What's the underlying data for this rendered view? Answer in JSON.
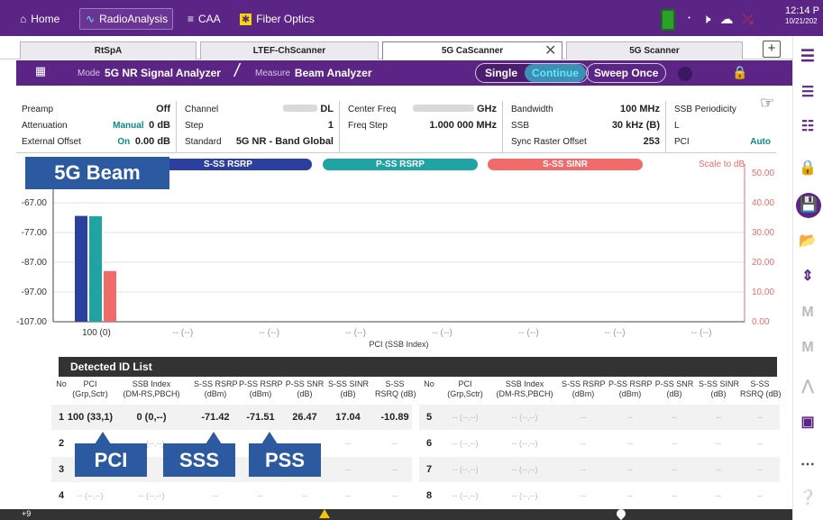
{
  "topbar": {
    "home": "Home",
    "radio_analysis": "RadioAnalysis",
    "caa": "CAA",
    "fiber_optics": "Fiber Optics",
    "time": "12:14 P",
    "date": "10/21/202"
  },
  "tabs": [
    {
      "label": "RtSpA"
    },
    {
      "label": "LTEF-ChScanner"
    },
    {
      "label": "5G CaScanner"
    },
    {
      "label": "5G Scanner"
    }
  ],
  "modebar": {
    "mode_label": "Mode",
    "mode_value": "5G NR Signal Analyzer",
    "measure_label": "Measure",
    "measure_value": "Beam Analyzer",
    "single": "Single",
    "continue": "Continue",
    "sweep_once": "Sweep Once"
  },
  "params": {
    "preamp_label": "Preamp",
    "preamp_value": "Off",
    "attenuation_label": "Attenuation",
    "attenuation_mode": "Manual",
    "attenuation_value": "0 dB",
    "ext_offset_label": "External Offset",
    "ext_offset_state": "On",
    "ext_offset_value": "0.00 dB",
    "channel_label": "Channel",
    "channel_suffix": "DL",
    "step_label": "Step",
    "step_value": "1",
    "standard_label": "Standard",
    "standard_value": "5G NR - Band Global",
    "center_freq_label": "Center Freq",
    "center_freq_unit": "GHz",
    "freq_step_label": "Freq Step",
    "freq_step_value": "1.000 000 MHz",
    "bandwidth_label": "Bandwidth",
    "bandwidth_value": "100 MHz",
    "ssb_label": "SSB",
    "ssb_value": "30 kHz (B)",
    "sync_raster_label": "Sync Raster Offset",
    "sync_raster_value": "253",
    "ssb_periodicity_label": "SSB Periodicity",
    "ssb_periodicity_value": "L",
    "pci_label": "PCI",
    "pci_value": "Auto"
  },
  "chart_legend": {
    "sss_rsrp": "S-SS RSRP",
    "pss_rsrp": "P-SS RSRP",
    "sss_sinr": "S-SS SINR",
    "scale": "Scale to dB"
  },
  "chart_data": {
    "type": "bar",
    "xlabel": "PCI (SSB Index)",
    "categories": [
      "100 (0)",
      "-- (--)",
      "-- (--)",
      "-- (--)",
      "-- (--)",
      "-- (--)",
      "-- (--)",
      "-- (--)"
    ],
    "y_left_ticks": [
      "-67.00",
      "-77.00",
      "-87.00",
      "-97.00",
      "-107.00"
    ],
    "y_right_ticks": [
      "50.00",
      "40.00",
      "30.00",
      "20.00",
      "10.00",
      "0.00"
    ],
    "ylim_left": [
      -107,
      -57
    ],
    "ylim_right": [
      0,
      50
    ],
    "series": [
      {
        "name": "S-SS RSRP",
        "color": "#2b3f9e",
        "axis": "left",
        "values": [
          -71.42
        ]
      },
      {
        "name": "P-SS RSRP",
        "color": "#1fa3a3",
        "axis": "left",
        "values": [
          -71.51
        ]
      },
      {
        "name": "S-SS SINR",
        "color": "#f26b6b",
        "axis": "right",
        "values": [
          17.04
        ]
      }
    ]
  },
  "callouts": {
    "beam": "5G Beam",
    "pci": "PCI",
    "sss": "SSS",
    "pss": "PSS"
  },
  "table": {
    "title": "Detected ID List",
    "headers": [
      "No",
      "PCI\n(Grp,Sctr)",
      "SSB Index\n(DM-RS,PBCH)",
      "S-SS RSRP\n(dBm)",
      "P-SS RSRP\n(dBm)",
      "P-SS SNR\n(dB)",
      "S-SS SINR\n(dB)",
      "S-SS\nRSRQ (dB)"
    ],
    "rows_left": [
      {
        "no": "1",
        "pci": "100 (33,1)",
        "ssb": "0 (0,--)",
        "sss_rsrp": "-71.42",
        "pss_rsrp": "-71.51",
        "pss_snr": "26.47",
        "sss_sinr": "17.04",
        "sss_rsrq": "-10.89"
      },
      {
        "no": "2",
        "pci": "",
        "ssb": "-- (--,--)",
        "sss_rsrp": "",
        "pss_rsrp": "--",
        "pss_snr": "--",
        "sss_sinr": "--",
        "sss_rsrq": "--"
      },
      {
        "no": "3",
        "pci": "",
        "ssb": "",
        "sss_rsrp": "",
        "pss_rsrp": "",
        "pss_snr": "--",
        "sss_sinr": "--",
        "sss_rsrq": "--"
      },
      {
        "no": "4",
        "pci": "-- (--,--)",
        "ssb": "-- (--,--)",
        "sss_rsrp": "--",
        "pss_rsrp": "--",
        "pss_snr": "--",
        "sss_sinr": "--",
        "sss_rsrq": "--"
      }
    ],
    "rows_right": [
      {
        "no": "5",
        "pci": "-- (--,--)",
        "ssb": "-- (--,--)",
        "sss_rsrp": "--",
        "pss_rsrp": "--",
        "pss_snr": "--",
        "sss_sinr": "--",
        "sss_rsrq": "--"
      },
      {
        "no": "6",
        "pci": "-- (--,--)",
        "ssb": "-- (--,--)",
        "sss_rsrp": "--",
        "pss_rsrp": "--",
        "pss_snr": "--",
        "sss_sinr": "--",
        "sss_rsrq": "--"
      },
      {
        "no": "7",
        "pci": "-- (--,--)",
        "ssb": "-- (--,--)",
        "sss_rsrp": "--",
        "pss_rsrp": "--",
        "pss_snr": "--",
        "sss_sinr": "--",
        "sss_rsrq": "--"
      },
      {
        "no": "8",
        "pci": "-- (--,--)",
        "ssb": "-- (--,--)",
        "sss_rsrp": "--",
        "pss_rsrp": "--",
        "pss_snr": "--",
        "sss_sinr": "--",
        "sss_rsrq": "--"
      }
    ]
  },
  "bottombar": {
    "left_count": "+9"
  }
}
